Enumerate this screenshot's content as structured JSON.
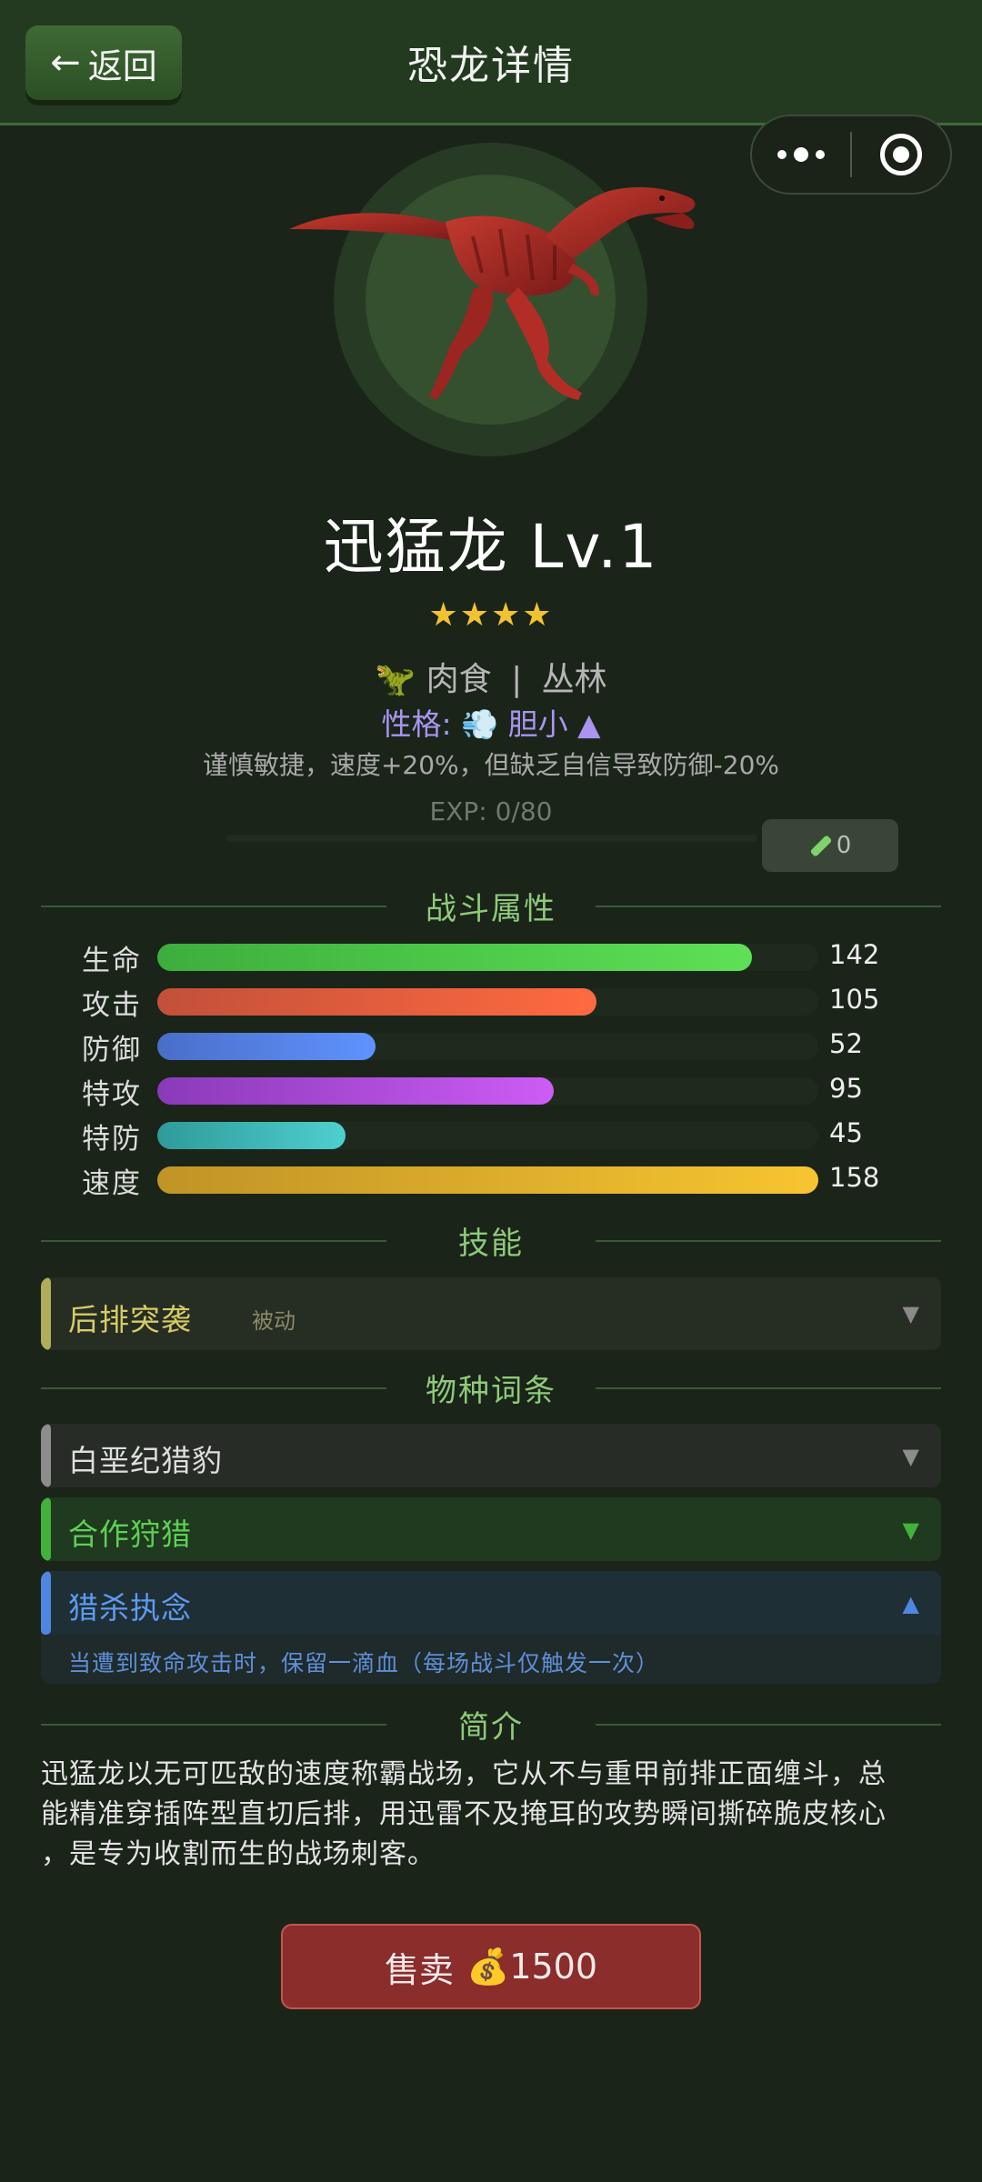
{
  "header": {
    "back_label": "返回",
    "title": "恐龙详情"
  },
  "capsule": {
    "more_icon": "more-dots-icon",
    "close_icon": "target-circle-icon"
  },
  "dino": {
    "name_level": "迅猛龙  Lv.1",
    "stars": "★★★★",
    "star_count": 4,
    "diet": "肉食",
    "divider": "|",
    "habitat": "丛林",
    "personality_label": "性格:",
    "personality_name": "胆小",
    "personality_desc": "谨慎敏捷，速度+20%，但缺乏自信导致防御-20%",
    "exp": "EXP: 0/80",
    "exp_progress": 0,
    "item_count": "0"
  },
  "sections": {
    "stats": "战斗属性",
    "skills": "技能",
    "traits": "物种词条",
    "intro": "简介"
  },
  "stats": [
    {
      "label": "生命",
      "value": "142",
      "fraction": 0.9,
      "color_from": "#3dae3d",
      "color_to": "#5ee056"
    },
    {
      "label": "攻击",
      "value": "105",
      "fraction": 0.665,
      "color_from": "#c2503a",
      "color_to": "#ff6a40"
    },
    {
      "label": "防御",
      "value": "52",
      "fraction": 0.33,
      "color_from": "#4a6ec8",
      "color_to": "#5f93ff"
    },
    {
      "label": "特攻",
      "value": "95",
      "fraction": 0.6,
      "color_from": "#8a3ab8",
      "color_to": "#cc5cf5"
    },
    {
      "label": "特防",
      "value": "45",
      "fraction": 0.285,
      "color_from": "#2f9a9a",
      "color_to": "#4fcfcf"
    },
    {
      "label": "速度",
      "value": "158",
      "fraction": 1.0,
      "color_from": "#c09426",
      "color_to": "#f7c530"
    }
  ],
  "skill": {
    "name": "后排突袭",
    "tag": "被动",
    "expanded": false
  },
  "traits": [
    {
      "name": "白垩纪猎豹",
      "expanded": false
    },
    {
      "name": "合作狩猎",
      "expanded": false
    },
    {
      "name": "猎杀执念",
      "expanded": true,
      "desc": "当遭到致命攻击时，保留一滴血（每场战斗仅触发一次）"
    }
  ],
  "intro_lines": [
    "迅猛龙以无可匹敌的速度称霸战场，它从不与重甲前排正面缠斗，总",
    "能精准穿插阵型直切后排，用迅雷不及掩耳的攻势瞬间撕碎脆皮核心",
    "，是专为收割而生的战场刺客。"
  ],
  "sell": {
    "label": "售卖",
    "price": "1500",
    "coin_icon": "money-bag-icon"
  },
  "colors": {
    "background": "#1a2419",
    "header": "#233a20",
    "accent_green": "#8fca7a",
    "sell_red": "#8a2d2b"
  }
}
